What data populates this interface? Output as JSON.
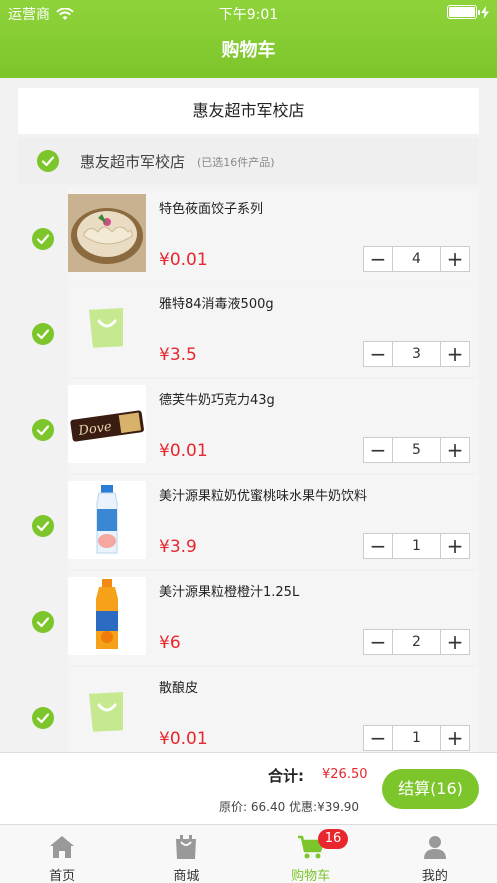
{
  "status_bar": {
    "carrier": "运营商",
    "time": "下午9:01",
    "battery_level": 1.0
  },
  "header": {
    "title": "购物车"
  },
  "store": {
    "card_name": "惠友超市军校店",
    "bar_name": "惠友超市军校店",
    "selected_count": "(已选16件产品)"
  },
  "items": [
    {
      "name": "特色莜面饺子系列",
      "price": "¥0.01",
      "qty": "4",
      "thumb": "dumplings"
    },
    {
      "name": "雅特84消毒液500g",
      "price": "¥3.5",
      "qty": "3",
      "thumb": "placeholder"
    },
    {
      "name": "德芙牛奶巧克力43g",
      "price": "¥0.01",
      "qty": "5",
      "thumb": "chocolate"
    },
    {
      "name": "美汁源果粒奶优蜜桃味水果牛奶饮料",
      "price": "¥3.9",
      "qty": "1",
      "thumb": "milk-bottle"
    },
    {
      "name": "美汁源果粒橙橙汁1.25L",
      "price": "¥6",
      "qty": "2",
      "thumb": "orange-bottle"
    },
    {
      "name": "散酿皮",
      "price": "¥0.01",
      "qty": "1",
      "thumb": "placeholder"
    }
  ],
  "stepper": {
    "minus": "−",
    "plus": "+"
  },
  "totals": {
    "label": "合计:",
    "amount": "¥26.50",
    "original": "原价: 66.40 优惠:¥39.90",
    "checkout_label": "结算(16)"
  },
  "tabs": [
    {
      "label": "首页",
      "icon": "home-icon"
    },
    {
      "label": "商城",
      "icon": "shopping-bag-icon"
    },
    {
      "label": "购物车",
      "icon": "cart-icon",
      "active": true
    },
    {
      "label": "我的",
      "icon": "user-icon"
    }
  ],
  "cart_badge": "16",
  "colors": {
    "accent": "#7cc52a",
    "price": "#e8262e"
  }
}
